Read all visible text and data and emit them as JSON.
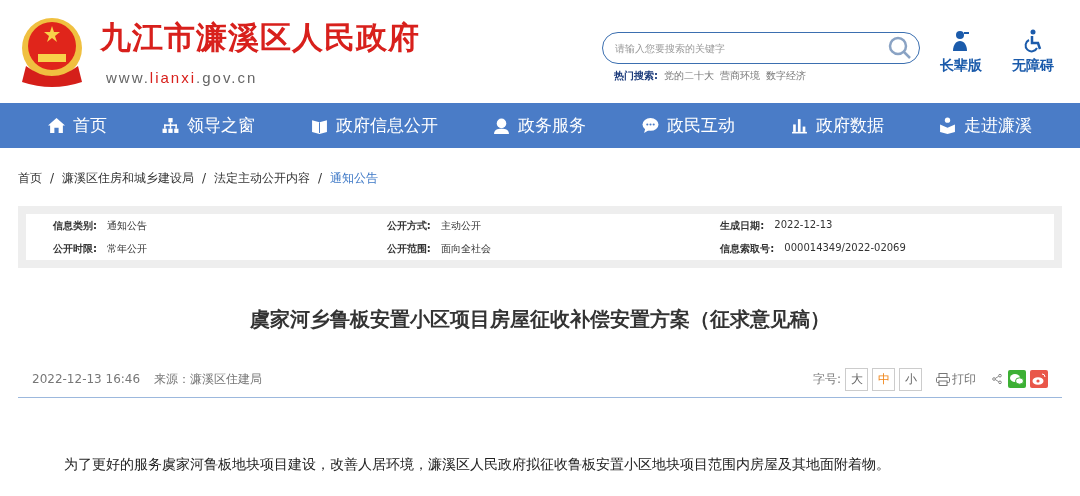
{
  "site": {
    "title": "九江市濂溪区人民政府",
    "url_prefix": "www.",
    "url_main": "lianxi",
    "url_suffix": ".gov.cn"
  },
  "search": {
    "placeholder": "请输入您要搜索的关键字",
    "hot_label": "热门搜索:",
    "hot_terms": [
      "党的二十大",
      "营商环境",
      "数字经济"
    ]
  },
  "tools": [
    {
      "kind": "elder",
      "label": "长辈版"
    },
    {
      "kind": "accessible",
      "label": "无障碍"
    }
  ],
  "nav": [
    {
      "label": "首页"
    },
    {
      "label": "领导之窗"
    },
    {
      "label": "政府信息公开"
    },
    {
      "label": "政务服务"
    },
    {
      "label": "政民互动"
    },
    {
      "label": "政府数据"
    },
    {
      "label": "走进濂溪"
    }
  ],
  "breadcrumb": [
    {
      "label": "首页",
      "current": false
    },
    {
      "separator": "/",
      "label": "濂溪区住房和城乡建设局",
      "current": false
    },
    {
      "separator": "/",
      "label": "法定主动公开内容",
      "current": false
    },
    {
      "separator": "/",
      "label": "通知公告",
      "current": true
    }
  ],
  "info": [
    {
      "label": "信息类别:",
      "value": "通知公告"
    },
    {
      "label": "公开方式:",
      "value": "主动公开"
    },
    {
      "label": "生成日期:",
      "value": "2022-12-13"
    },
    {
      "label": "公开时限:",
      "value": "常年公开"
    },
    {
      "label": "公开范围:",
      "value": "面向全社会"
    },
    {
      "label": "信息索取号:",
      "value": "000014349/2022-02069"
    }
  ],
  "article": {
    "title": "虞家河乡鲁板安置小区项目房屋征收补偿安置方案（征求意见稿）",
    "date": "2022-12-13 16:46",
    "source": "来源：濂溪区住建局",
    "font_label": "字号:",
    "font_sizes": [
      {
        "label": "大",
        "selected": false
      },
      {
        "label": "中",
        "selected": true
      },
      {
        "label": "小",
        "selected": false
      }
    ],
    "print": "打印",
    "body": "为了更好的服务虞家河鲁板地块项目建设，改善人居环境，濂溪区人民政府拟征收鲁板安置小区地块项目范围内房屋及其地面附着物。"
  }
}
